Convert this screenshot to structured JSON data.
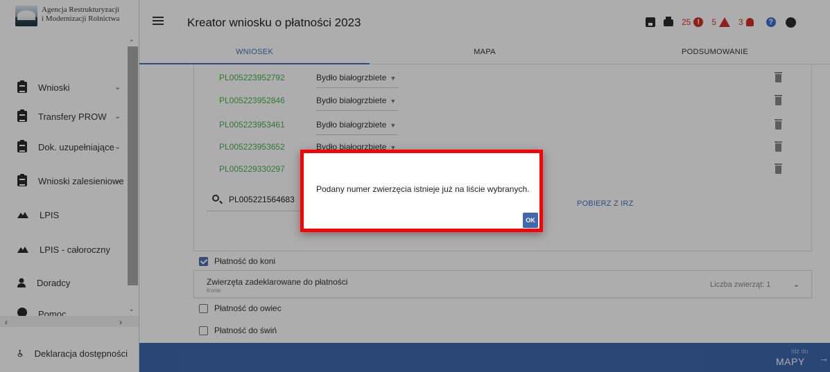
{
  "app": {
    "org_name_line1": "Agencja Restrukturyzacji",
    "org_name_line2": "i Modernizacji Rolnictwa",
    "title": "Kreator wniosku o płatności 2023"
  },
  "header": {
    "errors_count": "25",
    "warnings_count": "5",
    "notifications_count": "3",
    "icons": [
      "save-icon",
      "print-icon",
      "error-icon",
      "warning-icon",
      "bell-icon",
      "help-icon",
      "account-icon"
    ]
  },
  "tabs": [
    {
      "label": "WNIOSEK",
      "active": true
    },
    {
      "label": "MAPA",
      "active": false
    },
    {
      "label": "PODSUMOWANIE",
      "active": false
    }
  ],
  "sidebar": {
    "items": [
      {
        "label": "Wnioski",
        "icon": "clipboard-icon",
        "has_chevron": true
      },
      {
        "label": "Transfery PROW",
        "icon": "clipboard-icon",
        "has_chevron": true
      },
      {
        "label": "Dok. uzupełniające",
        "icon": "clipboard-icon",
        "has_chevron": true
      },
      {
        "label": "Wnioski zalesieniowe",
        "icon": "clipboard-icon",
        "has_chevron": true
      },
      {
        "label": "LPIS",
        "icon": "mountain-icon",
        "has_chevron": false
      },
      {
        "label": "LPIS - całoroczny",
        "icon": "mountain-icon",
        "has_chevron": false
      },
      {
        "label": "Doradcy",
        "icon": "person-icon",
        "has_chevron": false
      },
      {
        "label": "Pomoc",
        "icon": "help-icon",
        "has_chevron": true
      },
      {
        "label": "Deklaracja dostępności",
        "icon": "accessibility-icon",
        "has_chevron": false
      }
    ]
  },
  "animals": {
    "rows": [
      {
        "id": "PL005223952792",
        "type": "Bydło białogrzbiete"
      },
      {
        "id": "PL005223952846",
        "type": "Bydło białogrzbiete"
      },
      {
        "id": "PL005223953461",
        "type": "Bydło białogrzbiete"
      },
      {
        "id": "PL005223953652",
        "type": "Bydło białogrzbiete"
      },
      {
        "id": "PL005229330297",
        "type": ""
      }
    ],
    "search_value": "PL005221564683",
    "fetch_link": "POBIERZ Z IRZ"
  },
  "payments": {
    "horses": {
      "label": "Płatność do koni",
      "checked": true
    },
    "declared_title": "Zwierzęta zadeklarowane do płatności",
    "declared_subtitle": "Konie",
    "declared_count": "Liczba zwierząt: 1",
    "sheep": {
      "label": "Płatność do owiec",
      "checked": false
    },
    "pigs": {
      "label": "Płatność do świń",
      "checked": false
    }
  },
  "footer": {
    "goto_small": "Idź do",
    "goto_big": "MAPY"
  },
  "dialog": {
    "message": "Podany numer zwierzęcia istnieje już na liście wybranych.",
    "ok_label": "OK"
  },
  "colors": {
    "accent": "#3f68ad",
    "animal_id": "#4caf50",
    "alert": "#d32f2f",
    "highlight_frame": "#ff0000"
  }
}
